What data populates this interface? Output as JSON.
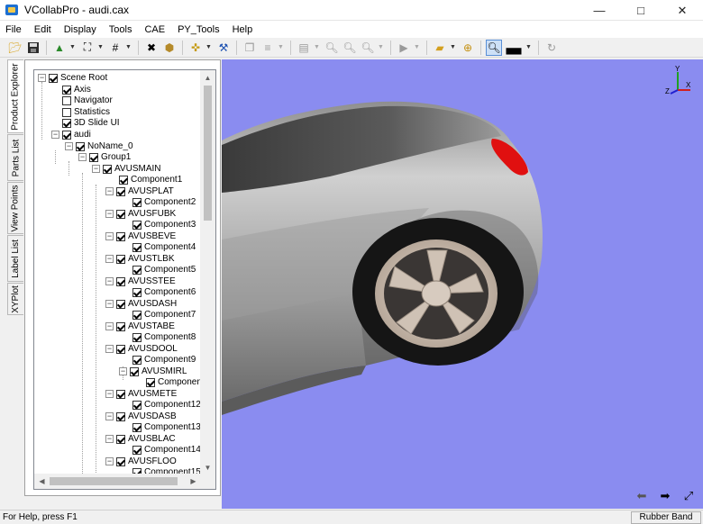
{
  "window": {
    "title": "VCollabPro - audi.cax"
  },
  "menu": [
    "File",
    "Edit",
    "Display",
    "Tools",
    "CAE",
    "PY_Tools",
    "Help"
  ],
  "side_tabs": [
    "Product Explorer",
    "Parts List",
    "View Points",
    "Label List",
    "XYPlot"
  ],
  "tree": {
    "scene_root": "Scene Root",
    "axis": "Axis",
    "navigator": "Navigator",
    "statistics": "Statistics",
    "slide_ui": "3D Slide UI",
    "audi": "audi",
    "noname": "NoName_0",
    "group": "Group1",
    "avusmain": "AVUSMAIN",
    "component1": "Component1",
    "avusplat": "AVUSPLAT",
    "component2": "Component2",
    "avusfubk": "AVUSFUBK",
    "component3": "Component3",
    "avusbeve": "AVUSBEVE",
    "component4": "Component4",
    "avustlbk": "AVUSTLBK",
    "component5": "Component5",
    "avusstee": "AVUSSTEE",
    "component6": "Component6",
    "avusdash": "AVUSDASH",
    "component7": "Component7",
    "avustabe": "AVUSTABE",
    "component8": "Component8",
    "avusdool": "AVUSDOOL",
    "component9": "Component9",
    "avusmirl": "AVUSMIRL",
    "componen": "Componen",
    "avusmete": "AVUSMETE",
    "component12": "Component12",
    "avusdasb": "AVUSDASB",
    "component13": "Component13",
    "avusblac": "AVUSBLAC",
    "component14": "Component14",
    "avusfloo": "AVUSFLOO",
    "component15": "Component15"
  },
  "viewport": {
    "background": "#8a8cf0",
    "axis_labels": {
      "y": "Y",
      "x": "X",
      "z": "Z"
    }
  },
  "status": {
    "text": "For Help, press F1",
    "mode": "Rubber Band Zoom"
  }
}
